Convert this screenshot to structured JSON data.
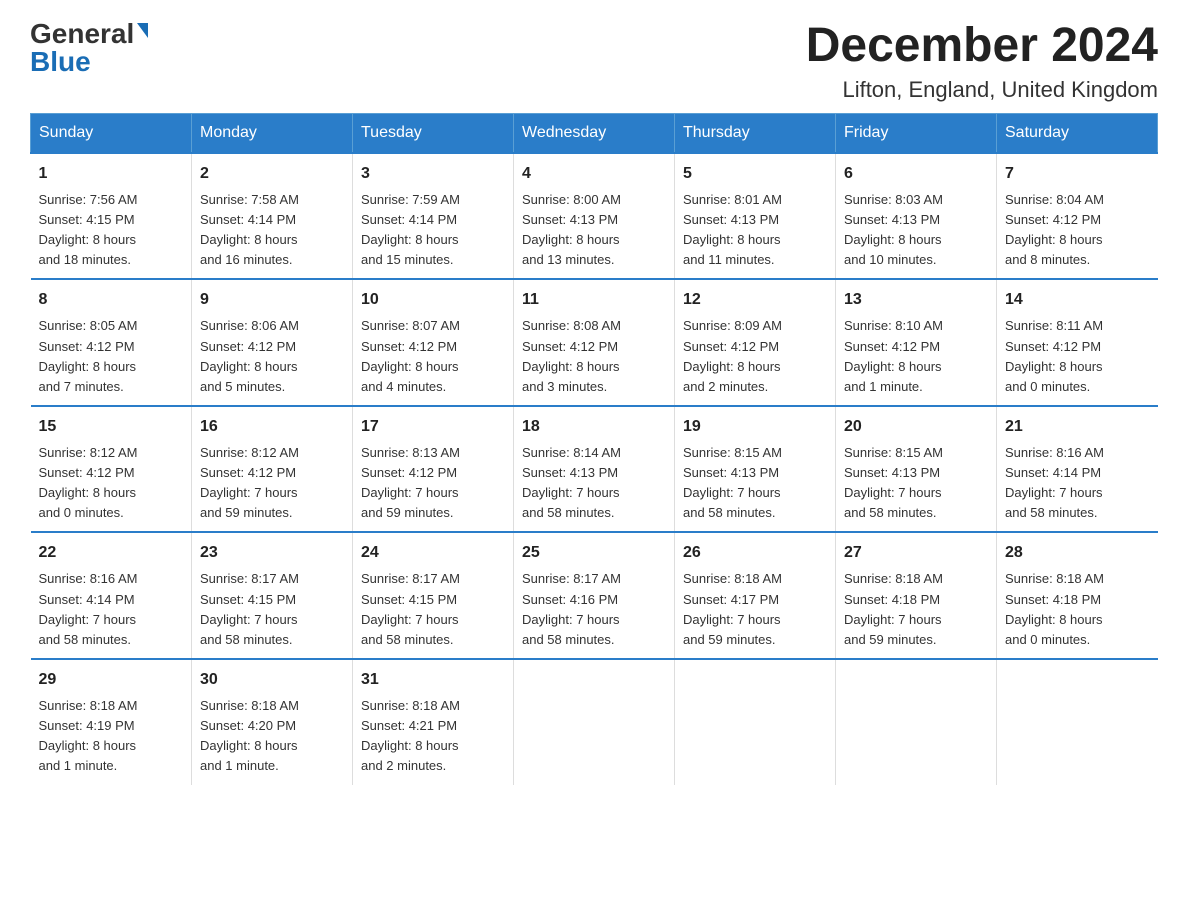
{
  "header": {
    "logo_general": "General",
    "logo_blue": "Blue",
    "month_title": "December 2024",
    "location": "Lifton, England, United Kingdom"
  },
  "days_of_week": [
    "Sunday",
    "Monday",
    "Tuesday",
    "Wednesday",
    "Thursday",
    "Friday",
    "Saturday"
  ],
  "weeks": [
    [
      {
        "day": "1",
        "sunrise": "Sunrise: 7:56 AM",
        "sunset": "Sunset: 4:15 PM",
        "daylight": "Daylight: 8 hours",
        "daylight2": "and 18 minutes."
      },
      {
        "day": "2",
        "sunrise": "Sunrise: 7:58 AM",
        "sunset": "Sunset: 4:14 PM",
        "daylight": "Daylight: 8 hours",
        "daylight2": "and 16 minutes."
      },
      {
        "day": "3",
        "sunrise": "Sunrise: 7:59 AM",
        "sunset": "Sunset: 4:14 PM",
        "daylight": "Daylight: 8 hours",
        "daylight2": "and 15 minutes."
      },
      {
        "day": "4",
        "sunrise": "Sunrise: 8:00 AM",
        "sunset": "Sunset: 4:13 PM",
        "daylight": "Daylight: 8 hours",
        "daylight2": "and 13 minutes."
      },
      {
        "day": "5",
        "sunrise": "Sunrise: 8:01 AM",
        "sunset": "Sunset: 4:13 PM",
        "daylight": "Daylight: 8 hours",
        "daylight2": "and 11 minutes."
      },
      {
        "day": "6",
        "sunrise": "Sunrise: 8:03 AM",
        "sunset": "Sunset: 4:13 PM",
        "daylight": "Daylight: 8 hours",
        "daylight2": "and 10 minutes."
      },
      {
        "day": "7",
        "sunrise": "Sunrise: 8:04 AM",
        "sunset": "Sunset: 4:12 PM",
        "daylight": "Daylight: 8 hours",
        "daylight2": "and 8 minutes."
      }
    ],
    [
      {
        "day": "8",
        "sunrise": "Sunrise: 8:05 AM",
        "sunset": "Sunset: 4:12 PM",
        "daylight": "Daylight: 8 hours",
        "daylight2": "and 7 minutes."
      },
      {
        "day": "9",
        "sunrise": "Sunrise: 8:06 AM",
        "sunset": "Sunset: 4:12 PM",
        "daylight": "Daylight: 8 hours",
        "daylight2": "and 5 minutes."
      },
      {
        "day": "10",
        "sunrise": "Sunrise: 8:07 AM",
        "sunset": "Sunset: 4:12 PM",
        "daylight": "Daylight: 8 hours",
        "daylight2": "and 4 minutes."
      },
      {
        "day": "11",
        "sunrise": "Sunrise: 8:08 AM",
        "sunset": "Sunset: 4:12 PM",
        "daylight": "Daylight: 8 hours",
        "daylight2": "and 3 minutes."
      },
      {
        "day": "12",
        "sunrise": "Sunrise: 8:09 AM",
        "sunset": "Sunset: 4:12 PM",
        "daylight": "Daylight: 8 hours",
        "daylight2": "and 2 minutes."
      },
      {
        "day": "13",
        "sunrise": "Sunrise: 8:10 AM",
        "sunset": "Sunset: 4:12 PM",
        "daylight": "Daylight: 8 hours",
        "daylight2": "and 1 minute."
      },
      {
        "day": "14",
        "sunrise": "Sunrise: 8:11 AM",
        "sunset": "Sunset: 4:12 PM",
        "daylight": "Daylight: 8 hours",
        "daylight2": "and 0 minutes."
      }
    ],
    [
      {
        "day": "15",
        "sunrise": "Sunrise: 8:12 AM",
        "sunset": "Sunset: 4:12 PM",
        "daylight": "Daylight: 8 hours",
        "daylight2": "and 0 minutes."
      },
      {
        "day": "16",
        "sunrise": "Sunrise: 8:12 AM",
        "sunset": "Sunset: 4:12 PM",
        "daylight": "Daylight: 7 hours",
        "daylight2": "and 59 minutes."
      },
      {
        "day": "17",
        "sunrise": "Sunrise: 8:13 AM",
        "sunset": "Sunset: 4:12 PM",
        "daylight": "Daylight: 7 hours",
        "daylight2": "and 59 minutes."
      },
      {
        "day": "18",
        "sunrise": "Sunrise: 8:14 AM",
        "sunset": "Sunset: 4:13 PM",
        "daylight": "Daylight: 7 hours",
        "daylight2": "and 58 minutes."
      },
      {
        "day": "19",
        "sunrise": "Sunrise: 8:15 AM",
        "sunset": "Sunset: 4:13 PM",
        "daylight": "Daylight: 7 hours",
        "daylight2": "and 58 minutes."
      },
      {
        "day": "20",
        "sunrise": "Sunrise: 8:15 AM",
        "sunset": "Sunset: 4:13 PM",
        "daylight": "Daylight: 7 hours",
        "daylight2": "and 58 minutes."
      },
      {
        "day": "21",
        "sunrise": "Sunrise: 8:16 AM",
        "sunset": "Sunset: 4:14 PM",
        "daylight": "Daylight: 7 hours",
        "daylight2": "and 58 minutes."
      }
    ],
    [
      {
        "day": "22",
        "sunrise": "Sunrise: 8:16 AM",
        "sunset": "Sunset: 4:14 PM",
        "daylight": "Daylight: 7 hours",
        "daylight2": "and 58 minutes."
      },
      {
        "day": "23",
        "sunrise": "Sunrise: 8:17 AM",
        "sunset": "Sunset: 4:15 PM",
        "daylight": "Daylight: 7 hours",
        "daylight2": "and 58 minutes."
      },
      {
        "day": "24",
        "sunrise": "Sunrise: 8:17 AM",
        "sunset": "Sunset: 4:15 PM",
        "daylight": "Daylight: 7 hours",
        "daylight2": "and 58 minutes."
      },
      {
        "day": "25",
        "sunrise": "Sunrise: 8:17 AM",
        "sunset": "Sunset: 4:16 PM",
        "daylight": "Daylight: 7 hours",
        "daylight2": "and 58 minutes."
      },
      {
        "day": "26",
        "sunrise": "Sunrise: 8:18 AM",
        "sunset": "Sunset: 4:17 PM",
        "daylight": "Daylight: 7 hours",
        "daylight2": "and 59 minutes."
      },
      {
        "day": "27",
        "sunrise": "Sunrise: 8:18 AM",
        "sunset": "Sunset: 4:18 PM",
        "daylight": "Daylight: 7 hours",
        "daylight2": "and 59 minutes."
      },
      {
        "day": "28",
        "sunrise": "Sunrise: 8:18 AM",
        "sunset": "Sunset: 4:18 PM",
        "daylight": "Daylight: 8 hours",
        "daylight2": "and 0 minutes."
      }
    ],
    [
      {
        "day": "29",
        "sunrise": "Sunrise: 8:18 AM",
        "sunset": "Sunset: 4:19 PM",
        "daylight": "Daylight: 8 hours",
        "daylight2": "and 1 minute."
      },
      {
        "day": "30",
        "sunrise": "Sunrise: 8:18 AM",
        "sunset": "Sunset: 4:20 PM",
        "daylight": "Daylight: 8 hours",
        "daylight2": "and 1 minute."
      },
      {
        "day": "31",
        "sunrise": "Sunrise: 8:18 AM",
        "sunset": "Sunset: 4:21 PM",
        "daylight": "Daylight: 8 hours",
        "daylight2": "and 2 minutes."
      },
      null,
      null,
      null,
      null
    ]
  ]
}
